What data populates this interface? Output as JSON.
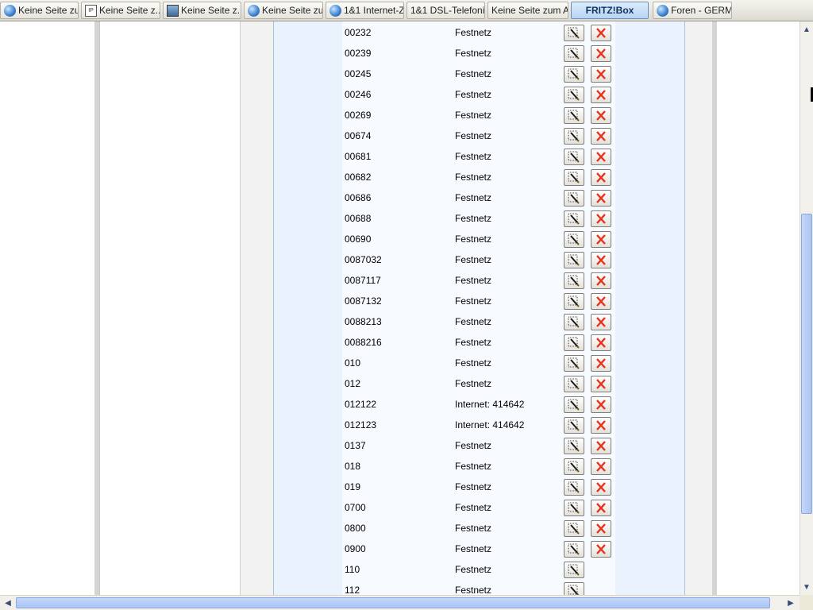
{
  "tabs": [
    {
      "label": "Keine Seite zu...",
      "icon": "globe-icon",
      "active": false
    },
    {
      "label": "Keine Seite z...",
      "icon": "ip-document-icon",
      "active": false
    },
    {
      "label": "Keine Seite z...",
      "icon": "image-icon",
      "active": false
    },
    {
      "label": "Keine Seite zu...",
      "icon": "globe-icon",
      "active": false
    },
    {
      "label": "1&1 Internet-Z...",
      "icon": "globe-icon",
      "active": false
    },
    {
      "label": "1&1 DSL-Telefoni...",
      "icon": "",
      "active": false
    },
    {
      "label": "Keine Seite zum A...",
      "icon": "",
      "active": false
    },
    {
      "label": "FRITZ!Box",
      "icon": "",
      "active": true
    },
    {
      "label": "Foren - GERM...",
      "icon": "globe-icon",
      "active": false
    }
  ],
  "rows": [
    {
      "number": "00232",
      "type": "Festnetz",
      "edit": "edit-button",
      "delete": true
    },
    {
      "number": "00239",
      "type": "Festnetz",
      "delete": true
    },
    {
      "number": "00245",
      "type": "Festnetz",
      "delete": true
    },
    {
      "number": "00246",
      "type": "Festnetz",
      "delete": true
    },
    {
      "number": "00269",
      "type": "Festnetz",
      "delete": true
    },
    {
      "number": "00674",
      "type": "Festnetz",
      "delete": true
    },
    {
      "number": "00681",
      "type": "Festnetz",
      "delete": true
    },
    {
      "number": "00682",
      "type": "Festnetz",
      "delete": true
    },
    {
      "number": "00686",
      "type": "Festnetz",
      "delete": true
    },
    {
      "number": "00688",
      "type": "Festnetz",
      "delete": true
    },
    {
      "number": "00690",
      "type": "Festnetz",
      "delete": true
    },
    {
      "number": "0087032",
      "type": "Festnetz",
      "delete": true
    },
    {
      "number": "0087117",
      "type": "Festnetz",
      "delete": true
    },
    {
      "number": "0087132",
      "type": "Festnetz",
      "delete": true
    },
    {
      "number": "0088213",
      "type": "Festnetz",
      "delete": true
    },
    {
      "number": "0088216",
      "type": "Festnetz",
      "delete": true
    },
    {
      "number": "010",
      "type": "Festnetz",
      "delete": true
    },
    {
      "number": "012",
      "type": "Festnetz",
      "delete": true
    },
    {
      "number": "012122",
      "type": "Internet: 414642",
      "delete": true
    },
    {
      "number": "012123",
      "type": "Internet: 414642",
      "delete": true
    },
    {
      "number": "0137",
      "type": "Festnetz",
      "delete": true
    },
    {
      "number": "018",
      "type": "Festnetz",
      "delete": true
    },
    {
      "number": "019",
      "type": "Festnetz",
      "delete": true
    },
    {
      "number": "0700",
      "type": "Festnetz",
      "delete": true
    },
    {
      "number": "0800",
      "type": "Festnetz",
      "delete": true
    },
    {
      "number": "0900",
      "type": "Festnetz",
      "delete": true
    },
    {
      "number": "110",
      "type": "Festnetz",
      "delete": false
    },
    {
      "number": "112",
      "type": "Festnetz",
      "delete": false
    }
  ],
  "colors": {
    "delete_x": "#e8301c",
    "panel_bg": "#eaf2fd",
    "active_tab": "#b8d4f4",
    "scroll_thumb": "#aac4f3"
  }
}
